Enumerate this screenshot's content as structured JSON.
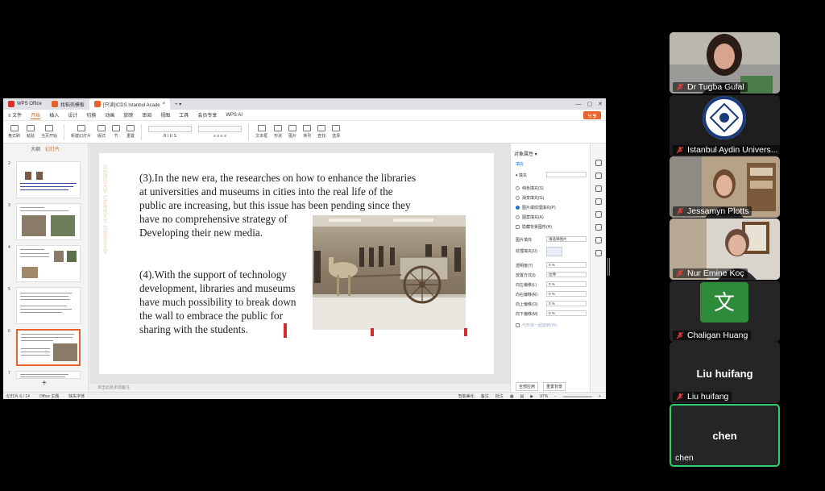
{
  "wps": {
    "tabs": [
      {
        "label": "WPS Office",
        "active": false
      },
      {
        "label": "找稻壳模板",
        "active": false
      },
      {
        "label": "[只读]ICDS Istanbul Acade",
        "active": true
      }
    ],
    "menu": [
      "≡ 文件",
      "开始",
      "插入",
      "设计",
      "切换",
      "动画",
      "放映",
      "审阅",
      "视图",
      "工具",
      "会员专享",
      "WPS AI"
    ],
    "active_menu": "开始",
    "share_label": "分享",
    "ribbon": [
      "格式刷",
      "粘贴",
      "当页开始",
      "新建幻灯片",
      "版式",
      "节",
      "重置",
      "文本框",
      "形状",
      "图片",
      "排列",
      "查找",
      "选择"
    ],
    "thumb_tabs": [
      "大纲",
      "幻灯片"
    ],
    "slide_numbers": [
      "2",
      "3",
      "4",
      "5",
      "6",
      "7"
    ],
    "slide": {
      "vertical_text": "北京师范大学 北京师范大学 北京师范大学",
      "p1": [
        "(3).In the new era, the researches on how to enhance the libraries",
        "at universities and museums in cities into the real life of the",
        "public are increasing, but this issue has been pending since they",
        "have no comprehensive strategy of",
        "Developing their new media."
      ],
      "p2": [
        "(4).With the support of technology",
        "development, libraries and museums",
        "have much possibility to break down",
        "the wall to embrace the public for",
        "sharing with the students."
      ]
    },
    "notes_placeholder": "单击此处添加备注",
    "props": {
      "title": "对象属性 ▾",
      "tab": "填充",
      "section": "▾ 填充",
      "options": [
        {
          "label": "纯色填充(S)",
          "on": false
        },
        {
          "label": "渐变填充(G)",
          "on": false
        },
        {
          "label": "图片或纹理填充(P)",
          "on": true
        },
        {
          "label": "图案填充(A)",
          "on": false
        },
        {
          "label": "隐藏背景图形(H)",
          "on": false
        }
      ],
      "fields": [
        {
          "label": "图片填充",
          "value": "请选择图片"
        },
        {
          "label": "纹理填充(U)",
          "value": ""
        },
        {
          "label": "透明度(T)",
          "value": "0 %"
        },
        {
          "label": "放置方式(I)",
          "value": "拉伸"
        },
        {
          "label": "向左偏移(L)",
          "value": "0 %"
        },
        {
          "label": "向右偏移(R)",
          "value": "0 %"
        },
        {
          "label": "向上偏移(O)",
          "value": "0 %"
        },
        {
          "label": "向下偏移(M)",
          "value": "0 %"
        }
      ],
      "checkbox": "与形状一起旋转(W)",
      "buttons": [
        "全部应用",
        "重置背景"
      ]
    },
    "status": {
      "slide_indicator": "幻灯片 6 / 14",
      "theme": "Office 主题",
      "font_missing": "缺失字体",
      "beautify": "智能美化",
      "notes": "备注",
      "comments": "批注",
      "zoom": "97%"
    }
  },
  "participants": [
    {
      "name": "Dr Tugba Gulal",
      "muted": true,
      "type": "video"
    },
    {
      "name": "Istanbul Aydin Univers...",
      "muted": true,
      "type": "logo"
    },
    {
      "name": "Jessamyn Plotts",
      "muted": true,
      "type": "video"
    },
    {
      "name": "Nur Emine Koç",
      "muted": true,
      "type": "video"
    },
    {
      "name": "Chaligan Huang",
      "muted": true,
      "type": "avatar",
      "avatar_char": "文"
    },
    {
      "name": "Liu huifang",
      "muted": true,
      "type": "name"
    },
    {
      "name": "chen",
      "muted": false,
      "type": "name",
      "speaking": true
    }
  ],
  "colors": {
    "accent_orange": "#e8622c",
    "active_border": "#2fd16a",
    "mute_red": "#e33c3c",
    "avatar_green": "#2e8b3a"
  }
}
